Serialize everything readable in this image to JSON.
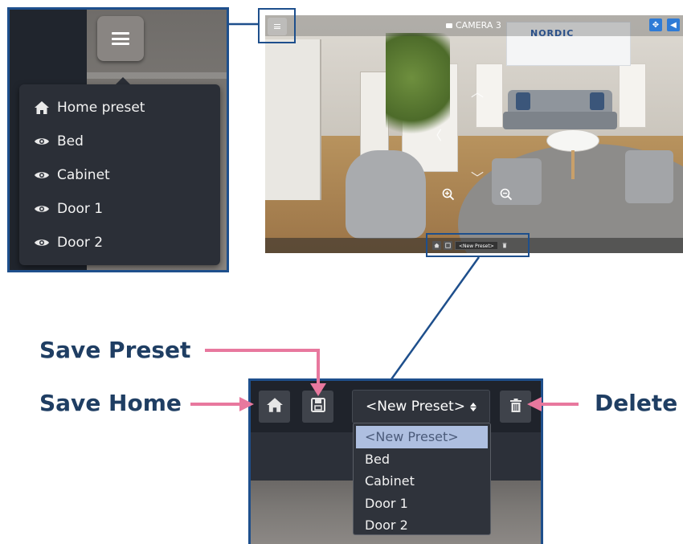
{
  "preset_menu": {
    "items": [
      {
        "label": "Home preset",
        "icon": "home-icon"
      },
      {
        "label": "Bed",
        "icon": "eye-icon"
      },
      {
        "label": "Cabinet",
        "icon": "eye-icon"
      },
      {
        "label": "Door 1",
        "icon": "eye-icon"
      },
      {
        "label": "Door 2",
        "icon": "eye-icon"
      }
    ]
  },
  "camera": {
    "title": "CAMERA 3",
    "logo": "NORDIC",
    "mini_select_label": "<New Preset>"
  },
  "controls": {
    "select_value": "<New Preset>",
    "options": [
      "<New Preset>",
      "Bed",
      "Cabinet",
      "Door 1",
      "Door 2"
    ]
  },
  "annotations": {
    "save_preset": "Save Preset",
    "save_home": "Save Home",
    "delete": "Delete"
  },
  "colors": {
    "callout_border": "#1e4f8c",
    "arrow_pink": "#e8789e",
    "label_navy": "#1f3e63",
    "selected_option_bg": "#aebfe0"
  }
}
